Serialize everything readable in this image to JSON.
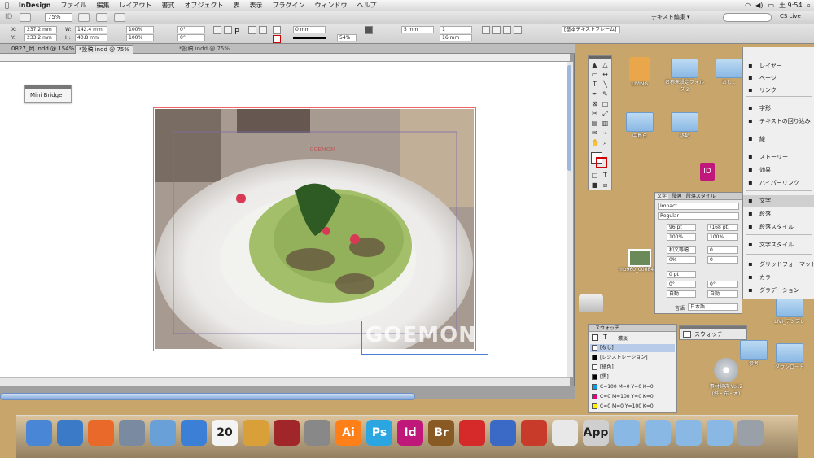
{
  "menubar": {
    "apple": "",
    "app": "InDesign",
    "items": [
      "ファイル",
      "編集",
      "レイアウト",
      "書式",
      "オブジェクト",
      "表",
      "表示",
      "プラグイン",
      "ウィンドウ",
      "ヘルプ"
    ],
    "clock": "土 9:54"
  },
  "appbar": {
    "zoom": "75%",
    "workspace": "テキスト編集 ▾",
    "cs_live": "CS Live"
  },
  "control": {
    "x": "237.2 mm",
    "y": "233.2 mm",
    "w": "142.4 mm",
    "h": "40.8 mm",
    "scale_x": "100%",
    "scale_y": "100%",
    "rotate": "0°",
    "shear": "0°",
    "stroke": "0 mm",
    "opacity": "54%",
    "offset1": "5 mm",
    "offset2": "16 mm",
    "columns": "1",
    "style": "[基本テキストフレーム]"
  },
  "tabs": [
    "",
    "0827_岡.indd @ 154%",
    "*投稿.indd @ 75%"
  ],
  "doc_title": "*投稿.indd @ 75%",
  "mini_bridge": "Mini Bridge",
  "overlay_text": "GOEMON",
  "plate_text": "GOEMON",
  "right_panel": [
    {
      "icon": "layers-icon",
      "label": "レイヤー"
    },
    {
      "icon": "pages-icon",
      "label": "ページ"
    },
    {
      "icon": "links-icon",
      "label": "リンク"
    },
    {
      "icon": "char-icon",
      "label": "字形"
    },
    {
      "icon": "wrap-icon",
      "label": "テキストの回り込み"
    },
    {
      "icon": "stroke-icon",
      "label": "線"
    },
    {
      "icon": "stroke2-icon",
      "label": "ストーリー"
    },
    {
      "icon": "fx-icon",
      "label": "効果"
    },
    {
      "icon": "hyperlink-icon",
      "label": "ハイパーリンク"
    },
    {
      "icon": "type-icon",
      "label": "文字"
    },
    {
      "icon": "para-icon",
      "label": "段落"
    },
    {
      "icon": "parastyle-icon",
      "label": "段落スタイル"
    },
    {
      "icon": "charstyle-icon",
      "label": "文字スタイル"
    },
    {
      "icon": "grid-icon",
      "label": "グリッドフォーマット"
    },
    {
      "icon": "color-icon",
      "label": "カラー"
    },
    {
      "icon": "gradient-icon",
      "label": "グラデーション"
    }
  ],
  "char_panel": {
    "tabs": [
      "文字",
      "段落",
      "段落スタイル"
    ],
    "font": "Impact",
    "style": "Regular",
    "size": "96 pt",
    "leading": "(168 pt)",
    "vscale": "100%",
    "hscale": "100%",
    "tsume": "和文等幅",
    "kerning": "0",
    "mojitsume": "0%",
    "tracking": "0",
    "baseline": "0 pt",
    "skew": "0°",
    "rotate": "0°",
    "auto1": "自動",
    "auto2": "自動",
    "lang_label": "言語",
    "lang": "日本語"
  },
  "swatches": {
    "title": "スウォッチ",
    "tint": "濃淡",
    "items": [
      {
        "name": "[なし]",
        "color": "#ffffff"
      },
      {
        "name": "[レジストレーション]",
        "color": "#000000"
      },
      {
        "name": "[紙色]",
        "color": "#ffffff"
      },
      {
        "name": "[黒]",
        "color": "#000000"
      },
      {
        "name": "C=100 M=0 Y=0 K=0",
        "color": "#00a0e9"
      },
      {
        "name": "C=0 M=100 Y=0 K=0",
        "color": "#e4007f"
      },
      {
        "name": "C=0 M=0 Y=100 K=0",
        "color": "#fff100"
      }
    ]
  },
  "swatch_popup": "スウォッチ",
  "desktop": {
    "icons": [
      "LIVING",
      "名称未設定フォルダ 2",
      "おし…",
      "中島ら",
      "移動",
      "mo960_00084_m.jpg",
      "LIVI_テンプレ",
      "ダウンロード",
      "参考",
      "素材辞典 Vol.2 (紙・布・木)",
      "ORT…"
    ]
  },
  "dock": [
    "Finder",
    "Safari",
    "Firefox",
    "Preview",
    "Mail",
    "iTunes",
    "20",
    "iPhoto",
    "Photo Booth",
    "System Prefs",
    "Ai",
    "Ps",
    "Id",
    "Br",
    "Acrobat",
    "Home",
    "Stuffit",
    "TextEdit",
    "App",
    "Folder",
    "Folder",
    "Folder",
    "Folder",
    "Trash"
  ]
}
